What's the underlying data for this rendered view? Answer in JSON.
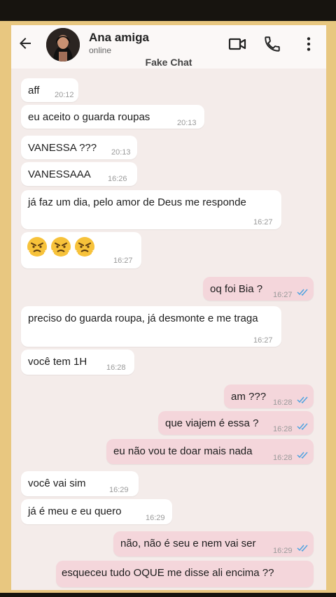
{
  "header": {
    "contact_name": "Ana amiga",
    "status": "online",
    "subtitle": "Fake Chat"
  },
  "messages": [
    {
      "dir": "in",
      "text": "aff",
      "time": "20:12"
    },
    {
      "dir": "in",
      "text": "eu aceito o guarda roupas",
      "time": "20:13"
    },
    {
      "dir": "in",
      "text": "VANESSA ???",
      "time": "20:13"
    },
    {
      "dir": "in",
      "text": "VANESSAAA",
      "time": "16:26"
    },
    {
      "dir": "in",
      "text": "já faz um dia, pelo amor de Deus me responde",
      "time": "16:27"
    },
    {
      "dir": "in",
      "text": "😤😤😤",
      "time": "16:27"
    },
    {
      "dir": "out",
      "text": "oq foi Bia ?",
      "time": "16:27"
    },
    {
      "dir": "in",
      "text": "preciso do guarda roupa, já desmonte e me traga",
      "time": "16:27"
    },
    {
      "dir": "in",
      "text": "você tem 1H",
      "time": "16:28"
    },
    {
      "dir": "out",
      "text": "am ???",
      "time": "16:28"
    },
    {
      "dir": "out",
      "text": "que viajem é essa ?",
      "time": "16:28"
    },
    {
      "dir": "out",
      "text": "eu não vou te doar mais nada",
      "time": "16:28"
    },
    {
      "dir": "in",
      "text": "você vai sim",
      "time": "16:29"
    },
    {
      "dir": "in",
      "text": "já é meu e eu quero",
      "time": "16:29"
    },
    {
      "dir": "out",
      "text": "não, não é seu e nem vai ser",
      "time": "16:29"
    },
    {
      "dir": "out",
      "text": "esqueceu tudo OQUE me disse ali encima ??",
      "time": ""
    }
  ],
  "colors": {
    "incoming_bubble": "#ffffff",
    "outgoing_bubble": "#f4d6db",
    "read_ticks": "#4fa3e0",
    "frame": "#e8c780"
  },
  "icons": [
    "back-arrow-icon",
    "video-call-icon",
    "phone-icon",
    "more-vert-icon",
    "double-check-icon",
    "angry-face-icon"
  ]
}
